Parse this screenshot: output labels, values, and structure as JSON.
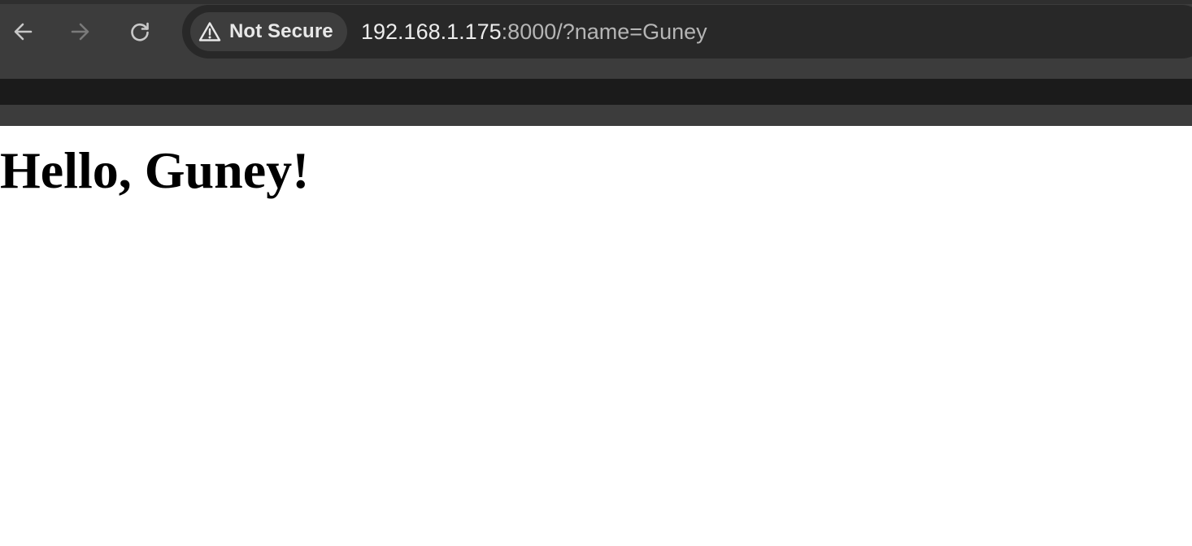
{
  "browser": {
    "nav": {
      "back_icon": "arrow-left-icon",
      "forward_icon": "arrow-right-icon",
      "reload_icon": "reload-icon"
    },
    "address_bar": {
      "security_label": "Not Secure",
      "security_icon": "warning-triangle-icon",
      "url_host": "192.168.1.175",
      "url_rest": ":8000/?name=Guney"
    }
  },
  "page": {
    "heading": "Hello, Guney!"
  },
  "colors": {
    "toolbar": "#3c3c3c",
    "omnibox": "#282828",
    "bookmarks_bar": "#1b1b1b",
    "page_background": "#ffffff"
  }
}
